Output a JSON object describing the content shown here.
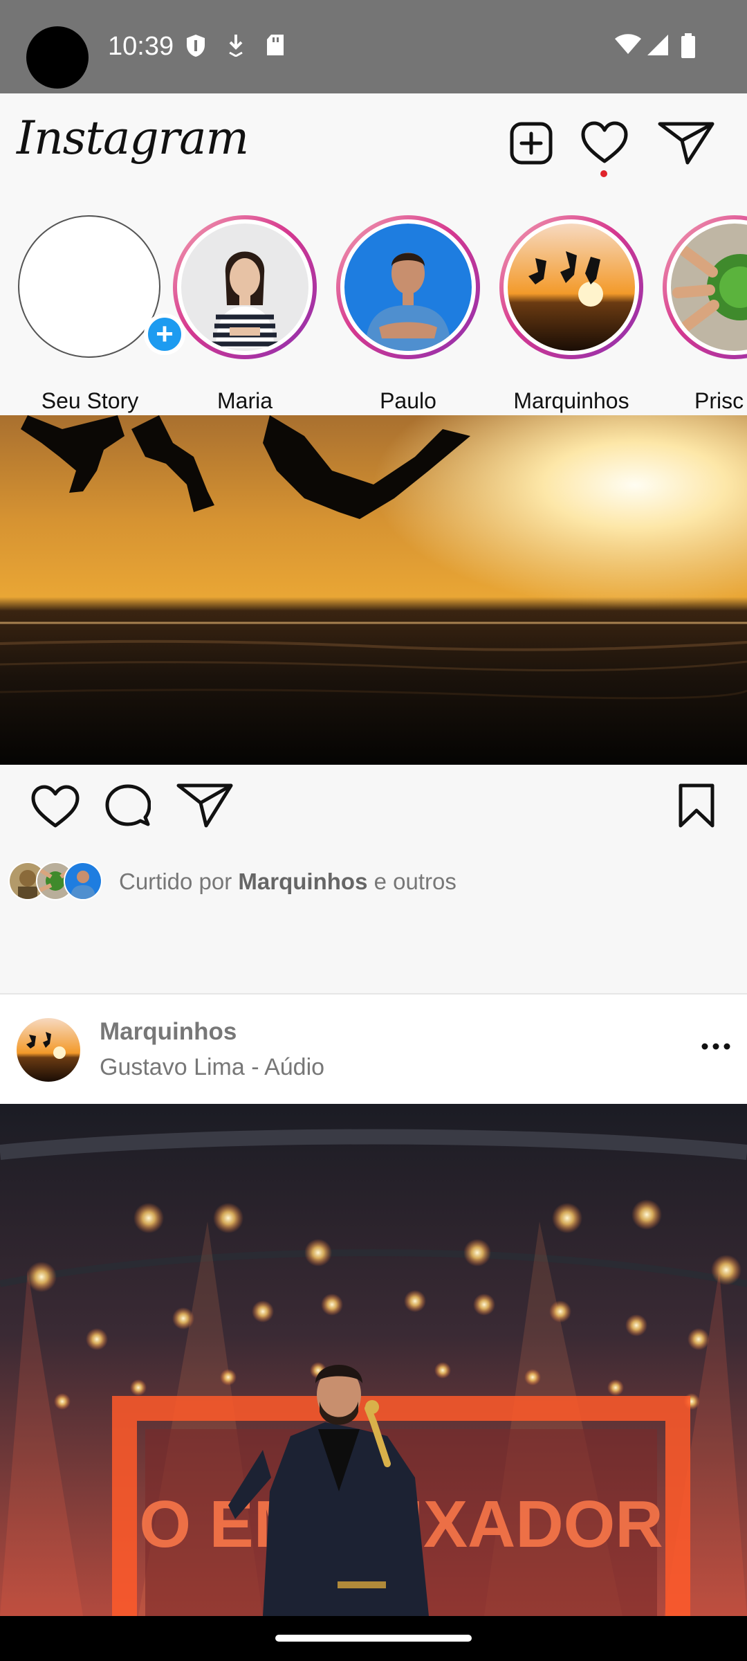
{
  "status_bar": {
    "time": "10:39",
    "left_icons": [
      "shield-icon",
      "download-icon",
      "sd-card-icon"
    ],
    "right_icons": [
      "wifi-icon",
      "signal-icon",
      "battery-icon"
    ]
  },
  "header": {
    "logo_text": "Instagram",
    "icons": [
      "new-post-icon",
      "heart-icon",
      "direct-message-icon"
    ],
    "has_notification_dot": true
  },
  "stories": [
    {
      "name": "Seu Story",
      "own": true
    },
    {
      "name": "Maria"
    },
    {
      "name": "Paulo"
    },
    {
      "name": "Marquinhos"
    },
    {
      "name": "Prisc"
    }
  ],
  "post1": {
    "actions": [
      "like-icon",
      "comment-icon",
      "share-icon",
      "save-icon"
    ],
    "liked_prefix": "Curtido por ",
    "liked_user": "Marquinhos",
    "liked_suffix": " e outros"
  },
  "post2": {
    "username": "Marquinhos",
    "audio": "Gustavo Lima - Aúdio",
    "stage_text": "O EMBAIXADOR"
  },
  "colors": {
    "accent_blue": "#1d9bf0",
    "notification_red": "#e0242b",
    "story_ring": "#d6398f"
  }
}
